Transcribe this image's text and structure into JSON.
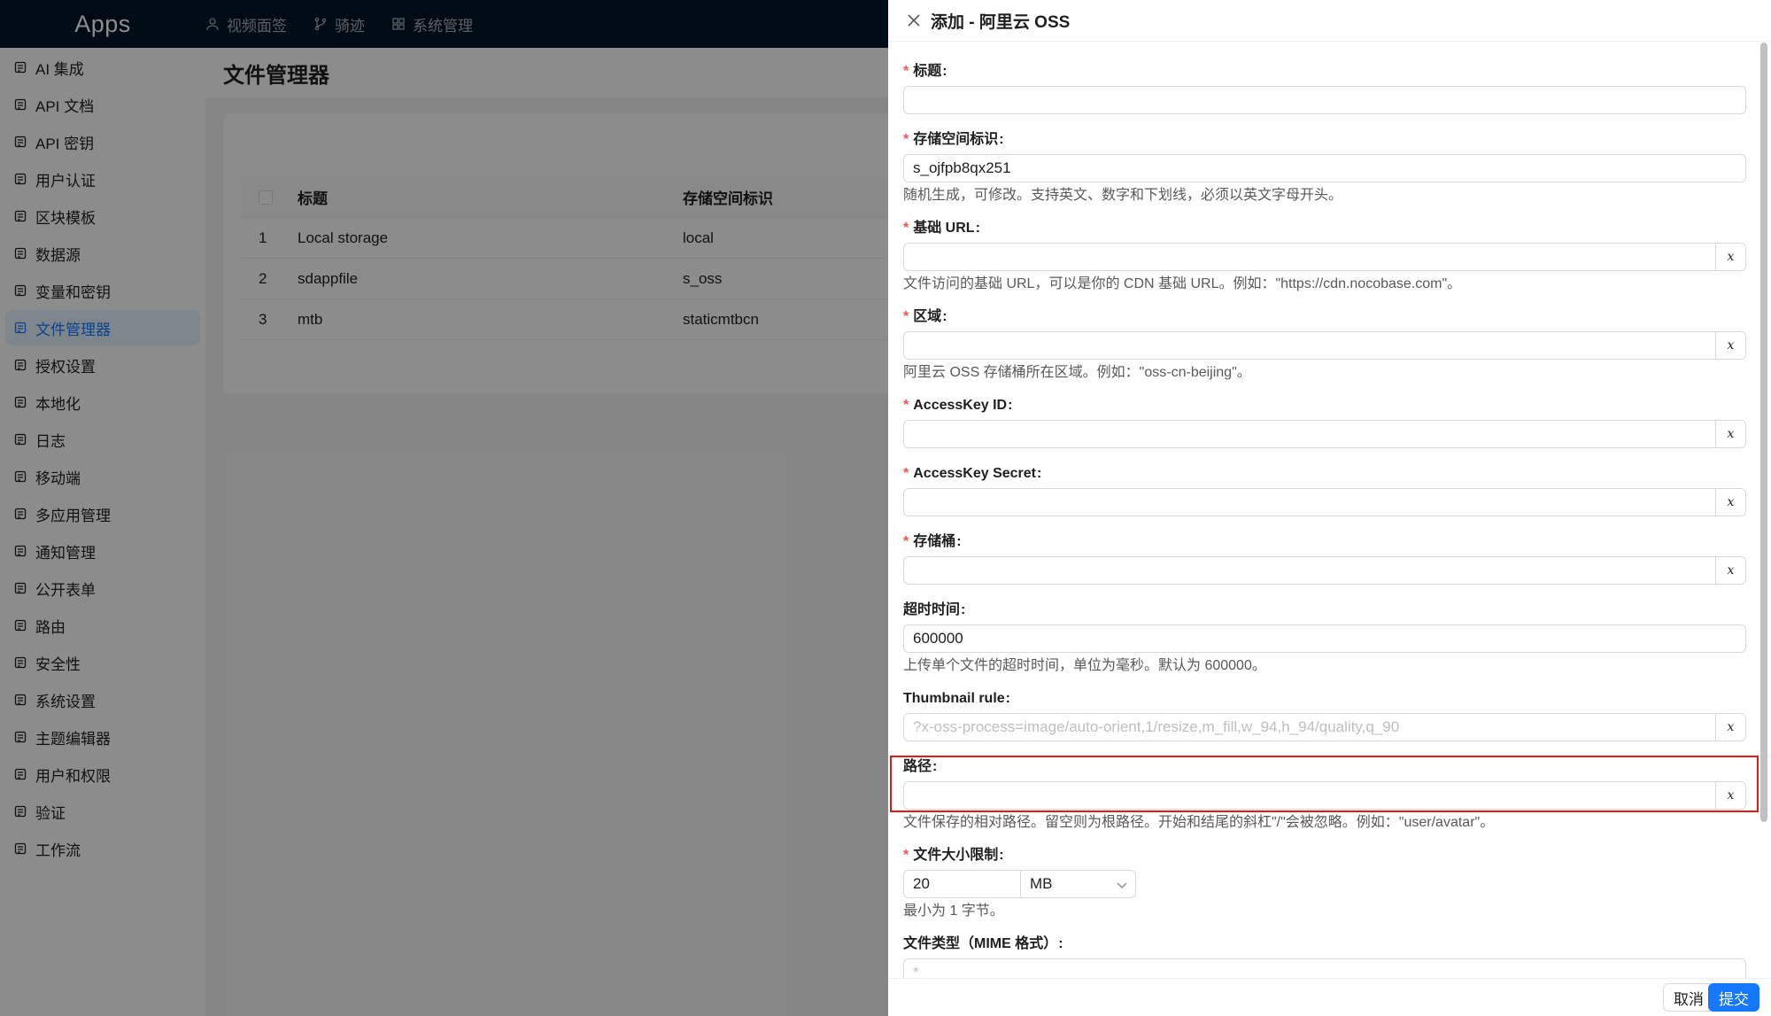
{
  "app": {
    "logo": "Apps"
  },
  "topnav": [
    {
      "label": "视频面签",
      "icon": "user-icon"
    },
    {
      "label": "骑迹",
      "icon": "branch-icon"
    },
    {
      "label": "系统管理",
      "icon": "apps-icon"
    }
  ],
  "sidebar": {
    "items": [
      {
        "label": "AI 集成",
        "icon": "robot-icon"
      },
      {
        "label": "API 文档",
        "icon": "book-icon"
      },
      {
        "label": "API 密钥",
        "icon": "key-icon"
      },
      {
        "label": "用户认证",
        "icon": "login-icon"
      },
      {
        "label": "区块模板",
        "icon": "layout-icon"
      },
      {
        "label": "数据源",
        "icon": "database-icon"
      },
      {
        "label": "变量和密钥",
        "icon": "table-icon"
      },
      {
        "label": "文件管理器",
        "icon": "file-icon",
        "active": true
      },
      {
        "label": "授权设置",
        "icon": "license-icon"
      },
      {
        "label": "本地化",
        "icon": "globe-icon"
      },
      {
        "label": "日志",
        "icon": "log-icon"
      },
      {
        "label": "移动端",
        "icon": "mobile-icon"
      },
      {
        "label": "多应用管理",
        "icon": "apps-icon"
      },
      {
        "label": "通知管理",
        "icon": "notification-icon"
      },
      {
        "label": "公开表单",
        "icon": "form-icon"
      },
      {
        "label": "路由",
        "icon": "route-icon"
      },
      {
        "label": "安全性",
        "icon": "shield-icon"
      },
      {
        "label": "系统设置",
        "icon": "gear-icon"
      },
      {
        "label": "主题编辑器",
        "icon": "theme-icon"
      },
      {
        "label": "用户和权限",
        "icon": "users-icon"
      },
      {
        "label": "验证",
        "icon": "check-circle-icon"
      },
      {
        "label": "工作流",
        "icon": "workflow-icon"
      }
    ]
  },
  "page": {
    "title": "文件管理器"
  },
  "table": {
    "columns": [
      "标题",
      "存储空间标识"
    ],
    "rows": [
      {
        "index": "1",
        "title": "Local storage",
        "name": "local"
      },
      {
        "index": "2",
        "title": "sdappfile",
        "name": "s_oss"
      },
      {
        "index": "3",
        "title": "mtb",
        "name": "staticmtbcn"
      }
    ]
  },
  "drawer": {
    "title": "添加 - 阿里云 OSS",
    "colon": ":",
    "required_mark": "*",
    "clear_symbol": "x",
    "fields": {
      "title": {
        "label": "标题",
        "value": ""
      },
      "storage_name": {
        "label": "存储空间标识",
        "value": "s_ojfpb8qx251",
        "help": "随机生成，可修改。支持英文、数字和下划线，必须以英文字母开头。"
      },
      "base_url": {
        "label": "基础 URL",
        "value": "",
        "help": "文件访问的基础 URL，可以是你的 CDN 基础 URL。例如：\"https://cdn.nocobase.com\"。"
      },
      "region": {
        "label": "区域",
        "value": "",
        "help": "阿里云 OSS 存储桶所在区域。例如：\"oss-cn-beijing\"。"
      },
      "access_key_id": {
        "label": "AccessKey ID",
        "value": ""
      },
      "access_key_secret": {
        "label": "AccessKey Secret",
        "value": ""
      },
      "bucket": {
        "label": "存储桶",
        "value": ""
      },
      "timeout": {
        "label": "超时时间",
        "value": "600000",
        "help": "上传单个文件的超时时间，单位为毫秒。默认为 600000。"
      },
      "thumbnail_rule": {
        "label": "Thumbnail rule",
        "placeholder": "?x-oss-process=image/auto-orient,1/resize,m_fill,w_94,h_94/quality,q_90"
      },
      "path": {
        "label": "路径",
        "value": "",
        "help": "文件保存的相对路径。留空则为根路径。开始和结尾的斜杠\"/\"会被忽略。例如：\"user/avatar\"。"
      },
      "size_limit": {
        "label": "文件大小限制",
        "value": "20",
        "unit": "MB",
        "help": "最小为 1 字节。"
      },
      "mime": {
        "label": "文件类型（MIME 格式）",
        "placeholder": "*"
      }
    },
    "footer": {
      "cancel": "取消",
      "submit": "提交"
    }
  },
  "colors": {
    "accent": "#1677ff",
    "required": "#ff4d4f",
    "highlight_box": "#e8161b",
    "topbar": "#001529"
  }
}
